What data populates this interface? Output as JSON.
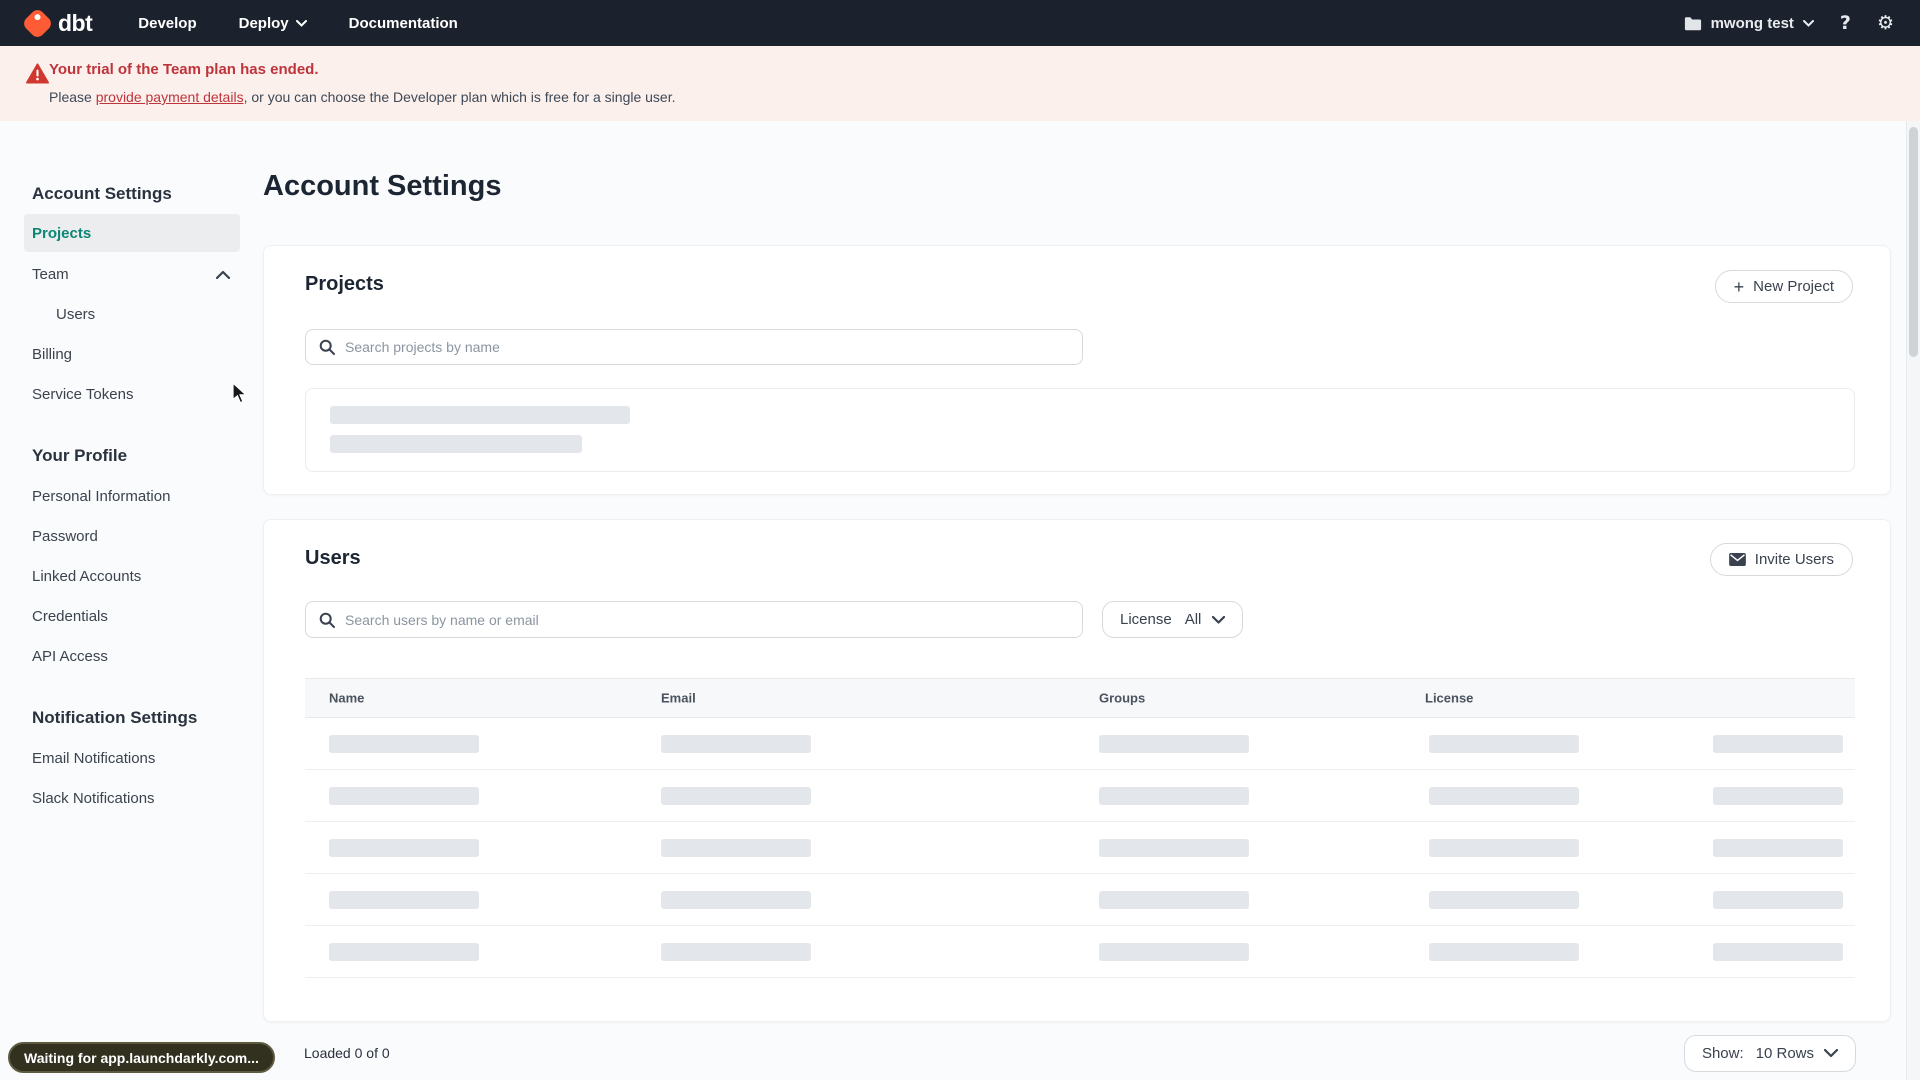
{
  "nav": {
    "logo": "dbt",
    "menu": [
      {
        "label": "Develop"
      },
      {
        "label": "Deploy"
      },
      {
        "label": "Documentation"
      }
    ],
    "account_name": "mwong test",
    "icons": {
      "help": "?",
      "gear": "⚙",
      "plus": "+"
    }
  },
  "banner": {
    "title": "Your trial of the Team plan has ended.",
    "body_prefix": "Please ",
    "link_text": "provide payment details",
    "body_suffix": ", or you can choose the Developer plan which is free for a single user."
  },
  "sidebar": {
    "sections": [
      {
        "heading": "Account Settings",
        "items": [
          {
            "label": "Projects"
          },
          {
            "label": "Team"
          },
          {
            "label": "Users"
          },
          {
            "label": "Billing"
          },
          {
            "label": "Service Tokens"
          }
        ]
      },
      {
        "heading": "Your Profile",
        "items": [
          {
            "label": "Personal Information"
          },
          {
            "label": "Password"
          },
          {
            "label": "Linked Accounts"
          },
          {
            "label": "Credentials"
          },
          {
            "label": "API Access"
          }
        ]
      },
      {
        "heading": "Notification Settings",
        "items": [
          {
            "label": "Email Notifications"
          },
          {
            "label": "Slack Notifications"
          }
        ]
      }
    ]
  },
  "main": {
    "page_title": "Account Settings",
    "projects": {
      "heading": "Projects",
      "new_project_button": "New Project",
      "search_placeholder": "Search projects by name"
    },
    "users": {
      "heading": "Users",
      "invite_button": "Invite Users",
      "search_placeholder": "Search users by name or email",
      "license_label": "License",
      "license_value": "All",
      "columns": [
        "Name",
        "Email",
        "Groups",
        "License"
      ]
    },
    "footer": {
      "loaded": "Loaded 0 of 0",
      "show_label": "Show:",
      "show_value": "10 Rows"
    }
  },
  "status_bubble": "Waiting for app.launchdarkly.com...",
  "colors": {
    "nav_bg": "#1c222d",
    "brand_orange": "#ff5c35",
    "banner_bg": "#fcf0ed",
    "banner_red": "#bf343b",
    "active_teal": "#0c8675",
    "skeleton": "#e3e6ea"
  }
}
